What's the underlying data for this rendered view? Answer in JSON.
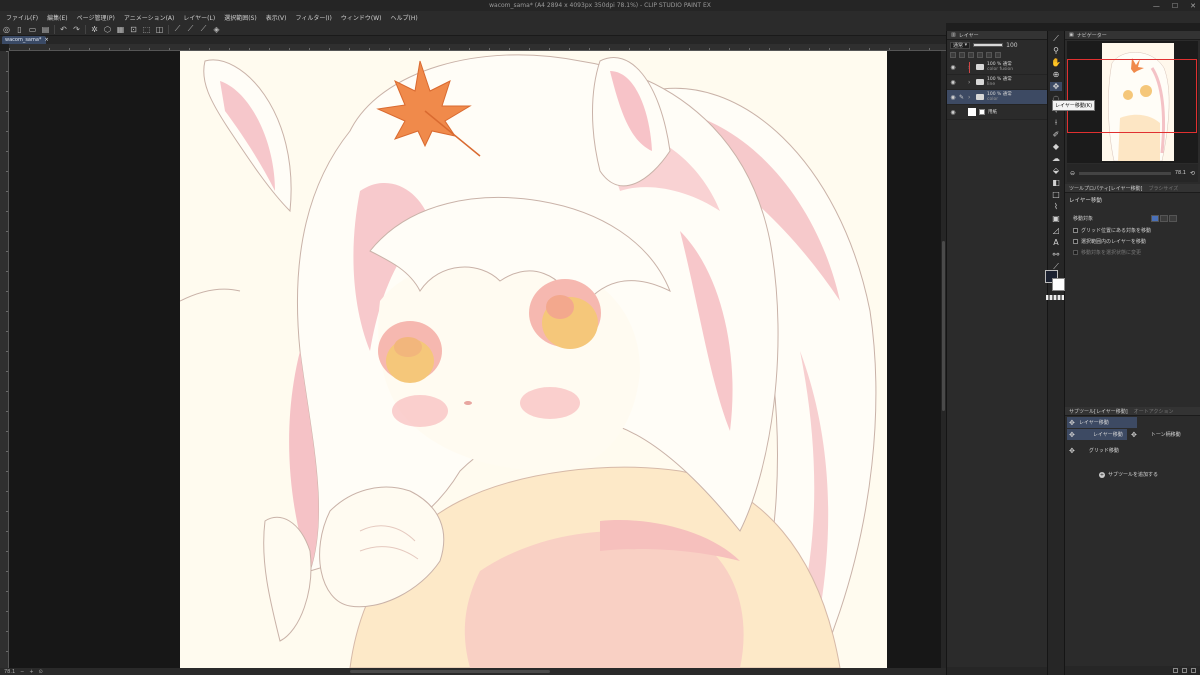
{
  "window": {
    "title": "wacom_sama* (A4 2894 x 4093px 350dpi 78.1%) - CLIP STUDIO PAINT EX",
    "minimize": "—",
    "maximize": "☐",
    "close": "✕"
  },
  "menu": [
    "ファイル(F)",
    "編集(E)",
    "ページ管理(P)",
    "アニメーション(A)",
    "レイヤー(L)",
    "選択範囲(S)",
    "表示(V)",
    "フィルター(I)",
    "ウィンドウ(W)",
    "ヘルプ(H)"
  ],
  "document_tab": {
    "label": "wacom_sama*",
    "close": "×"
  },
  "statusbar": {
    "zoom": "78.1"
  },
  "layer_panel": {
    "title": "レイヤー",
    "blend_mode": "通常",
    "opacity": "100",
    "layers": [
      {
        "name": "100 % 通常",
        "sub": "color fusion",
        "type": "folder",
        "clipped": true
      },
      {
        "name": "100 % 通常",
        "sub": "line",
        "type": "folder",
        "clipped": false
      },
      {
        "name": "100 % 通常",
        "sub": "color",
        "type": "folder",
        "clipped": false,
        "selected": true
      },
      {
        "name": "用紙",
        "sub": "",
        "type": "paper",
        "clipped": false
      }
    ]
  },
  "tooltip": "レイヤー移動(K)",
  "colors": {
    "foreground": "#1b2130",
    "background": "#ffffff",
    "accent": "#3d4a63"
  },
  "navigator": {
    "title": "ナビゲーター",
    "zoom": "78.1"
  },
  "tool_property": {
    "tab": "ツールプロパティ[レイヤー移動]",
    "tab2": "ブラシサイズ",
    "title": "レイヤー移動",
    "move_target_label": "移動対象",
    "options": [
      {
        "label": "グリッド位置にある対象を移動",
        "checked": false,
        "enabled": true
      },
      {
        "label": "選択範囲内のレイヤーを移動",
        "checked": false,
        "enabled": true
      },
      {
        "label": "移動対象を選択状態に変更",
        "checked": false,
        "enabled": false
      }
    ]
  },
  "sub_tool": {
    "tab": "サブツール[レイヤー移動]",
    "tab2": "オートアクション",
    "items": [
      {
        "label": "レイヤー移動",
        "selected": true
      },
      {
        "label": "レイヤー移動",
        "selected": true
      },
      {
        "label": "トーン柄移動",
        "selected": false
      },
      {
        "label": "グリッド移動",
        "selected": false
      }
    ],
    "add_label": "サブツールを追加する"
  }
}
